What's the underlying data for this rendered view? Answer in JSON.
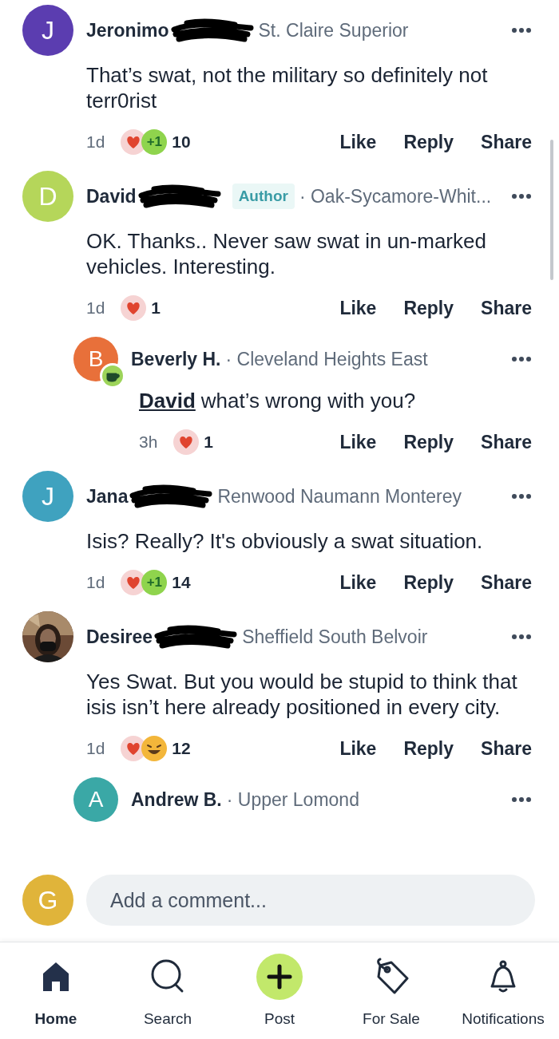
{
  "comments": [
    {
      "avatar": {
        "kind": "letter",
        "letter": "J",
        "color": "#5b3db0"
      },
      "name": "Jeronimo",
      "redacted": true,
      "badge": false,
      "location": "St. Claire Superior",
      "body": "That’s swat, not the military so definitely not terr0rist",
      "time": "1d",
      "reactions": [
        {
          "kind": "heart"
        },
        {
          "kind": "plus",
          "label": "+1"
        }
      ],
      "count": "10",
      "actions": [
        "Like",
        "Reply",
        "Share"
      ]
    },
    {
      "avatar": {
        "kind": "letter",
        "letter": "D",
        "color": "#b5d65a"
      },
      "name": "David",
      "redacted": true,
      "badge": false,
      "author_tag": "Author",
      "location": "· Oak-Sycamore-Whit...",
      "body": "OK. Thanks.. Never saw swat in un-marked vehicles. Interesting.",
      "time": "1d",
      "reactions": [
        {
          "kind": "heart"
        }
      ],
      "count": "1",
      "actions": [
        "Like",
        "Reply",
        "Share"
      ],
      "children": [
        {
          "avatar": {
            "kind": "letter",
            "letter": "B",
            "color": "#e8703a"
          },
          "name": "Beverly H.",
          "redacted": false,
          "badge": true,
          "location": "· Cleveland Heights East",
          "mention": "David",
          "body": "what’s wrong with you?",
          "time": "3h",
          "reactions": [
            {
              "kind": "heart"
            }
          ],
          "count": "1",
          "actions": [
            "Like",
            "Reply",
            "Share"
          ]
        }
      ]
    },
    {
      "avatar": {
        "kind": "letter",
        "letter": "J",
        "color": "#3fa2bf"
      },
      "name": "Jana",
      "redacted": true,
      "badge": false,
      "location": "Renwood Naumann Monterey",
      "body": "Isis?  Really?  It's obviously a swat situation.",
      "time": "1d",
      "reactions": [
        {
          "kind": "heart"
        },
        {
          "kind": "plus",
          "label": "+1"
        }
      ],
      "count": "14",
      "actions": [
        "Like",
        "Reply",
        "Share"
      ]
    },
    {
      "avatar": {
        "kind": "picture"
      },
      "name": "Desiree",
      "redacted": true,
      "badge": false,
      "location": "Sheffield South Belvoir",
      "body": "Yes Swat. But you would be stupid to think that isis isn’t here already positioned in every city.",
      "time": "1d",
      "reactions": [
        {
          "kind": "heart"
        },
        {
          "kind": "laugh"
        }
      ],
      "count": "12",
      "actions": [
        "Like",
        "Reply",
        "Share"
      ],
      "children": [
        {
          "avatar": {
            "kind": "letter",
            "letter": "A",
            "color": "#3aa8a6"
          },
          "name": "Andrew B.",
          "redacted": false,
          "badge": false,
          "location": "· Upper Lomond"
        }
      ]
    }
  ],
  "composer": {
    "avatar": {
      "kind": "letter",
      "letter": "G",
      "color": "#e0b43a"
    },
    "placeholder": "Add a comment..."
  },
  "nav": [
    {
      "kind": "home",
      "label": "Home",
      "selected": true
    },
    {
      "kind": "search",
      "label": "Search",
      "selected": false
    },
    {
      "kind": "post",
      "label": "Post",
      "selected": false
    },
    {
      "kind": "tag",
      "label": "For Sale",
      "selected": false
    },
    {
      "kind": "bell",
      "label": "Notifications",
      "selected": false
    }
  ]
}
